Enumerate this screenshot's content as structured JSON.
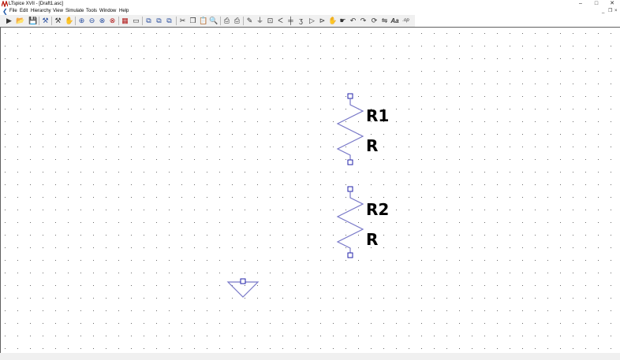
{
  "window": {
    "title": "LTspice XVII - [Draft1.asc]",
    "app_icon": "ltspice-app-icon",
    "controls": {
      "minimize": "–",
      "maximize": "□",
      "close": "✕"
    }
  },
  "menubar": {
    "items": [
      {
        "label": "File"
      },
      {
        "label": "Edit"
      },
      {
        "label": "Hierarchy"
      },
      {
        "label": "View"
      },
      {
        "label": "Simulate"
      },
      {
        "label": "Tools"
      },
      {
        "label": "Window"
      },
      {
        "label": "Help"
      }
    ],
    "mdi_controls": {
      "minimize": "_",
      "restore": "❐",
      "close": "×"
    }
  },
  "toolbar": {
    "buttons": [
      {
        "icon": "run-icon",
        "glyph": "▶"
      },
      {
        "icon": "open-icon",
        "glyph": "📂"
      },
      {
        "icon": "save-icon",
        "glyph": "💾"
      },
      {
        "icon": "control-panel-icon",
        "glyph": "⚒"
      },
      {
        "icon": "halt-icon",
        "glyph": "✋"
      },
      {
        "icon": "zoom-in-icon",
        "glyph": "⊕"
      },
      {
        "icon": "zoom-out-icon",
        "glyph": "⊖"
      },
      {
        "icon": "zoom-fit-icon",
        "glyph": "⊗"
      },
      {
        "icon": "autorange-icon",
        "glyph": "▦"
      },
      {
        "icon": "tile-icon",
        "glyph": "▭"
      },
      {
        "icon": "cascade-icon",
        "glyph": "⧉"
      },
      {
        "icon": "cut-icon",
        "glyph": "✂"
      },
      {
        "icon": "copy-icon",
        "glyph": "❐"
      },
      {
        "icon": "paste-icon",
        "glyph": "📋"
      },
      {
        "icon": "find-icon",
        "glyph": "🔍"
      },
      {
        "icon": "print-icon",
        "glyph": "⎙"
      },
      {
        "icon": "wire-icon",
        "glyph": "✎"
      },
      {
        "icon": "ground-icon",
        "glyph": "⏚"
      },
      {
        "icon": "label-net-icon",
        "glyph": "⊡"
      },
      {
        "icon": "resistor-icon",
        "glyph": "ᐸ"
      },
      {
        "icon": "capacitor-icon",
        "glyph": "╪"
      },
      {
        "icon": "inductor-icon",
        "glyph": "ʒ"
      },
      {
        "icon": "diode-icon",
        "glyph": "▷"
      },
      {
        "icon": "component-icon",
        "glyph": "⊳"
      },
      {
        "icon": "move-icon",
        "glyph": "✋"
      },
      {
        "icon": "drag-icon",
        "glyph": "☛"
      },
      {
        "icon": "undo-icon",
        "glyph": "↶"
      },
      {
        "icon": "redo-icon",
        "glyph": "↷"
      },
      {
        "icon": "rotate-icon",
        "glyph": "⟳"
      },
      {
        "icon": "mirror-icon",
        "glyph": "⇋"
      },
      {
        "icon": "text-icon",
        "glyph": "Aa"
      },
      {
        "icon": "spice-directive-icon",
        "glyph": ".op"
      }
    ]
  },
  "schematic": {
    "components": [
      {
        "name": "R1",
        "value": "R",
        "type": "resistor"
      },
      {
        "name": "R2",
        "value": "R",
        "type": "resistor"
      }
    ],
    "flags": [
      {
        "type": "ground"
      }
    ],
    "colors": {
      "grid_dot": "#6b6b6b",
      "component": "#7878c8",
      "pin": "#2222aa",
      "label": "#000000"
    }
  }
}
